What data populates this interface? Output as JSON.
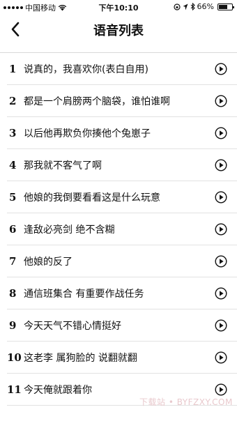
{
  "status_bar": {
    "carrier": "中国移动",
    "time": "下午10:10",
    "battery": "66%",
    "battery_level": 0.66
  },
  "nav": {
    "title": "语音列表"
  },
  "items": [
    {
      "number": "1",
      "text": "说真的，我喜欢你(表白自用)"
    },
    {
      "number": "2",
      "text": "都是一个肩膀两个脑袋，谁怕谁啊"
    },
    {
      "number": "3",
      "text": "以后他再欺负你揍他个兔崽子"
    },
    {
      "number": "4",
      "text": "那我就不客气了啊"
    },
    {
      "number": "5",
      "text": "他娘的我倒要看看这是什么玩意"
    },
    {
      "number": "6",
      "text": "逢敌必亮剑 绝不含糊"
    },
    {
      "number": "7",
      "text": "他娘的反了"
    },
    {
      "number": "8",
      "text": "通信班集合 有重要作战任务"
    },
    {
      "number": "9",
      "text": "今天天气不错心情挺好"
    },
    {
      "number": "10",
      "text": "这老李 属狗脸的 说翻就翻"
    },
    {
      "number": "11",
      "text": "今天俺就跟着你"
    }
  ],
  "watermark": "下载站 • BYFZXY.COM"
}
